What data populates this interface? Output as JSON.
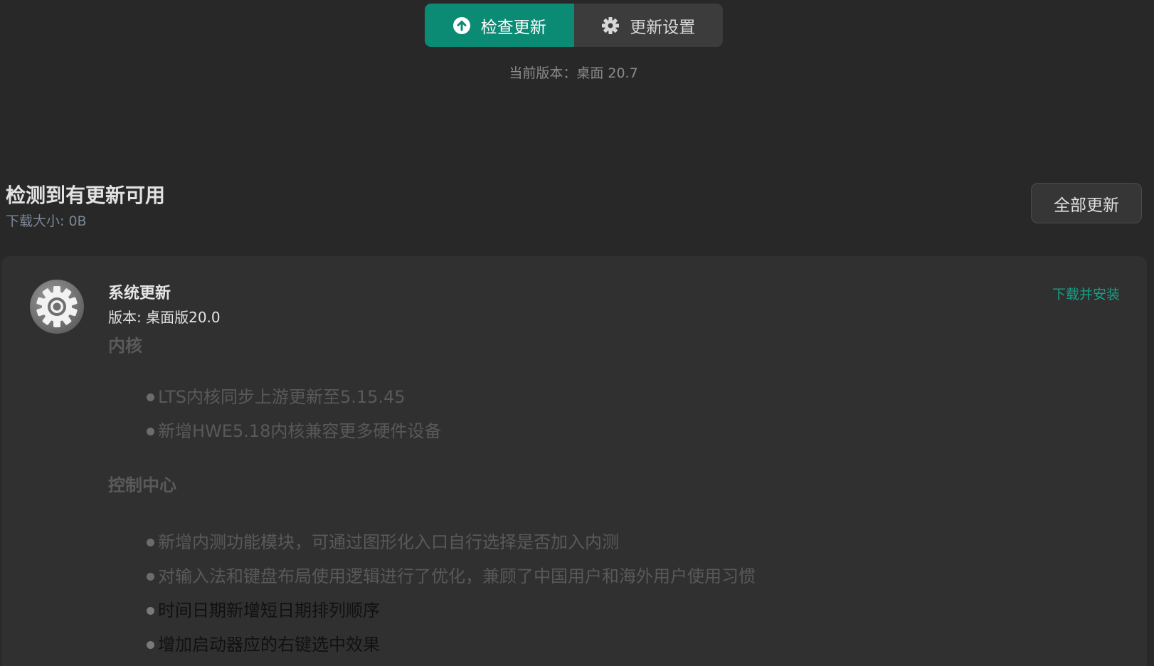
{
  "tabs": {
    "check_update": "检查更新",
    "update_settings": "更新设置"
  },
  "header": {
    "current_version": "当前版本：桌面 20.7"
  },
  "summary": {
    "title": "检测到有更新可用",
    "download_size": "下载大小: 0B",
    "update_all_label": "全部更新"
  },
  "update_item": {
    "name": "系统更新",
    "version": "版本: 桌面版20.0",
    "install_label": "下载并安装",
    "sections": [
      {
        "title": "内核",
        "items": [
          "LTS内核同步上游更新至5.15.45",
          "新增HWE5.18内核兼容更多硬件设备"
        ]
      },
      {
        "title": "控制中心",
        "items": [
          "新增内测功能模块，可通过图形化入口自行选择是否加入内测",
          "对输入法和键盘布局使用逻辑进行了优化，兼顾了中国用户和海外用户使用习惯",
          "时间日期新增短日期排列顺序",
          "增加启动器应的右键选中效果"
        ]
      }
    ]
  },
  "colors": {
    "accent": "#0b8a74",
    "link": "#16a085",
    "background": "#282828",
    "card": "#303030"
  },
  "icons": {
    "check_update": "upload-arrow-circle-icon",
    "settings": "gear-icon",
    "app": "gear-icon"
  }
}
